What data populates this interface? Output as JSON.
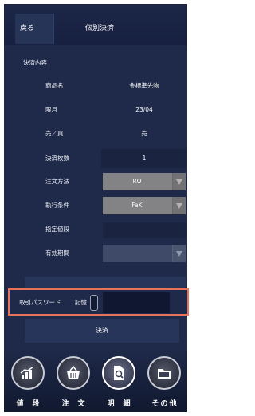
{
  "header": {
    "back_label": "戻る",
    "title": "個別決済"
  },
  "section_label": "決済内容",
  "rows": [
    {
      "label": "商品名",
      "value": "金標準先物"
    },
    {
      "label": "限月",
      "value": "23/04"
    },
    {
      "label": "売／買",
      "value": "売"
    },
    {
      "label": "決済枚数",
      "value": "1"
    },
    {
      "label": "注文方法",
      "value": "RO"
    },
    {
      "label": "執行条件",
      "value": "FaK"
    },
    {
      "label": "指定値段",
      "value": ""
    },
    {
      "label": "有効期間",
      "value": ""
    }
  ],
  "password": {
    "label": "取引パスワード",
    "memo_label": "記憶",
    "value": "",
    "placeholder": ""
  },
  "submit_label": "決済",
  "nav": [
    {
      "label": "値段",
      "icon": "chart-icon"
    },
    {
      "label": "注文",
      "icon": "basket-icon"
    },
    {
      "label": "明細",
      "icon": "document-search-icon"
    },
    {
      "label": "その他",
      "icon": "folder-icon"
    }
  ],
  "colors": {
    "background": "#1f2a4a",
    "highlight": "#e8735a",
    "select_gray": "#838386"
  }
}
